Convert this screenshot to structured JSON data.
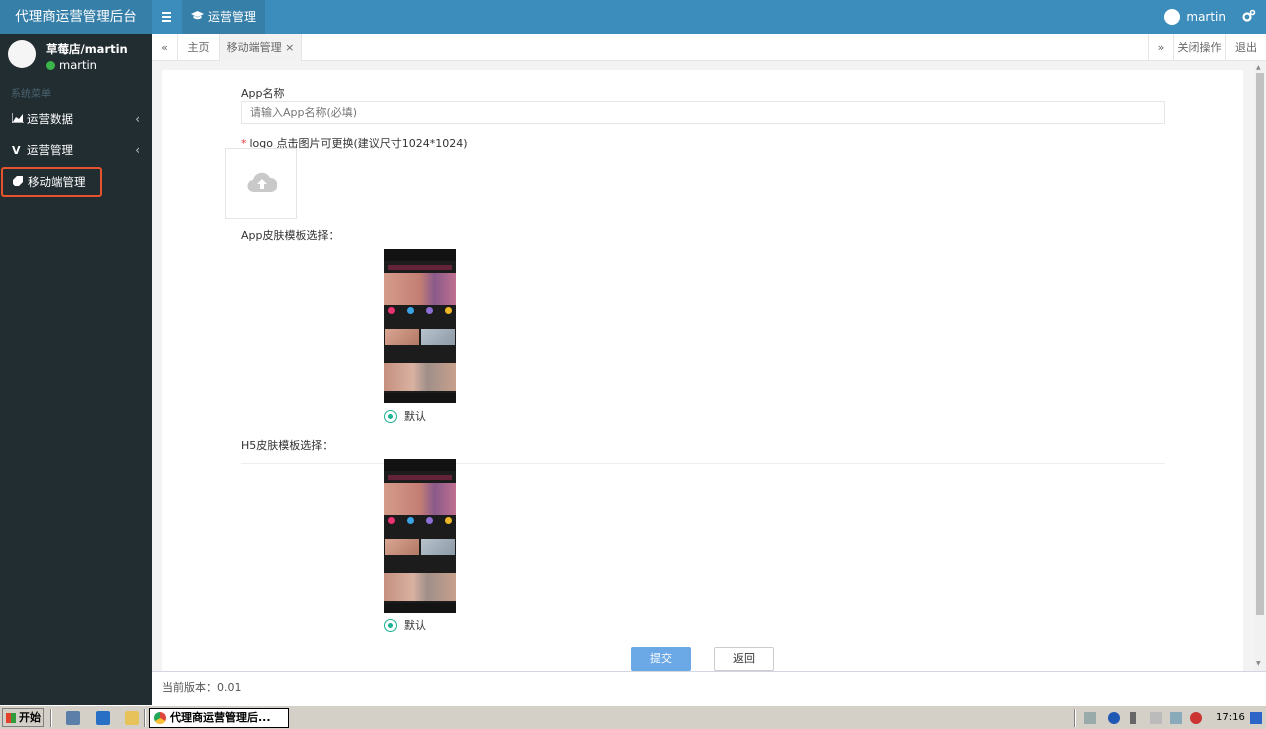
{
  "app": {
    "brand": "代理商运营管理后台",
    "top_nav_item": "运营管理",
    "user_name": "martin"
  },
  "sidebar": {
    "profile_name": "草莓店/martin",
    "profile_status": "martin",
    "menu_header": "系统菜单",
    "items": [
      {
        "label": "运营数据",
        "icon": "chart-area-icon",
        "has_children": true
      },
      {
        "label": "运营管理",
        "icon": "vimeo-icon",
        "has_children": true
      },
      {
        "label": "移动端管理",
        "icon": "tag-icon",
        "has_children": false,
        "active": true
      }
    ]
  },
  "tabs": {
    "prev": "«",
    "items": [
      {
        "label": "主页",
        "closable": false
      },
      {
        "label": "移动端管理",
        "closable": true,
        "close": "×",
        "active": true
      }
    ],
    "next": "»",
    "close_ops": "关闭操作",
    "logout": "退出"
  },
  "form": {
    "app_name_label": "App名称",
    "app_name_placeholder": "请输入App名称(必填)",
    "logo_required_mark": "*",
    "logo_label": "logo 点击图片可更换(建议尺寸1024*1024)",
    "app_skin_label": "App皮肤模板选择：",
    "app_skin_option": "默认",
    "h5_skin_label": "H5皮肤模板选择：",
    "h5_skin_option": "默认",
    "submit": "提交",
    "back": "返回"
  },
  "footer": {
    "version": "当前版本：0.01"
  },
  "taskbar": {
    "start": "开始",
    "task": "代理商运营管理后...",
    "clock": "17:16"
  },
  "colors": {
    "topbar": "#3c8dbc",
    "sidebar": "#222d32",
    "active_outline": "#e5532c",
    "radio": "#1ab394",
    "submit": "#6ba8e6"
  }
}
